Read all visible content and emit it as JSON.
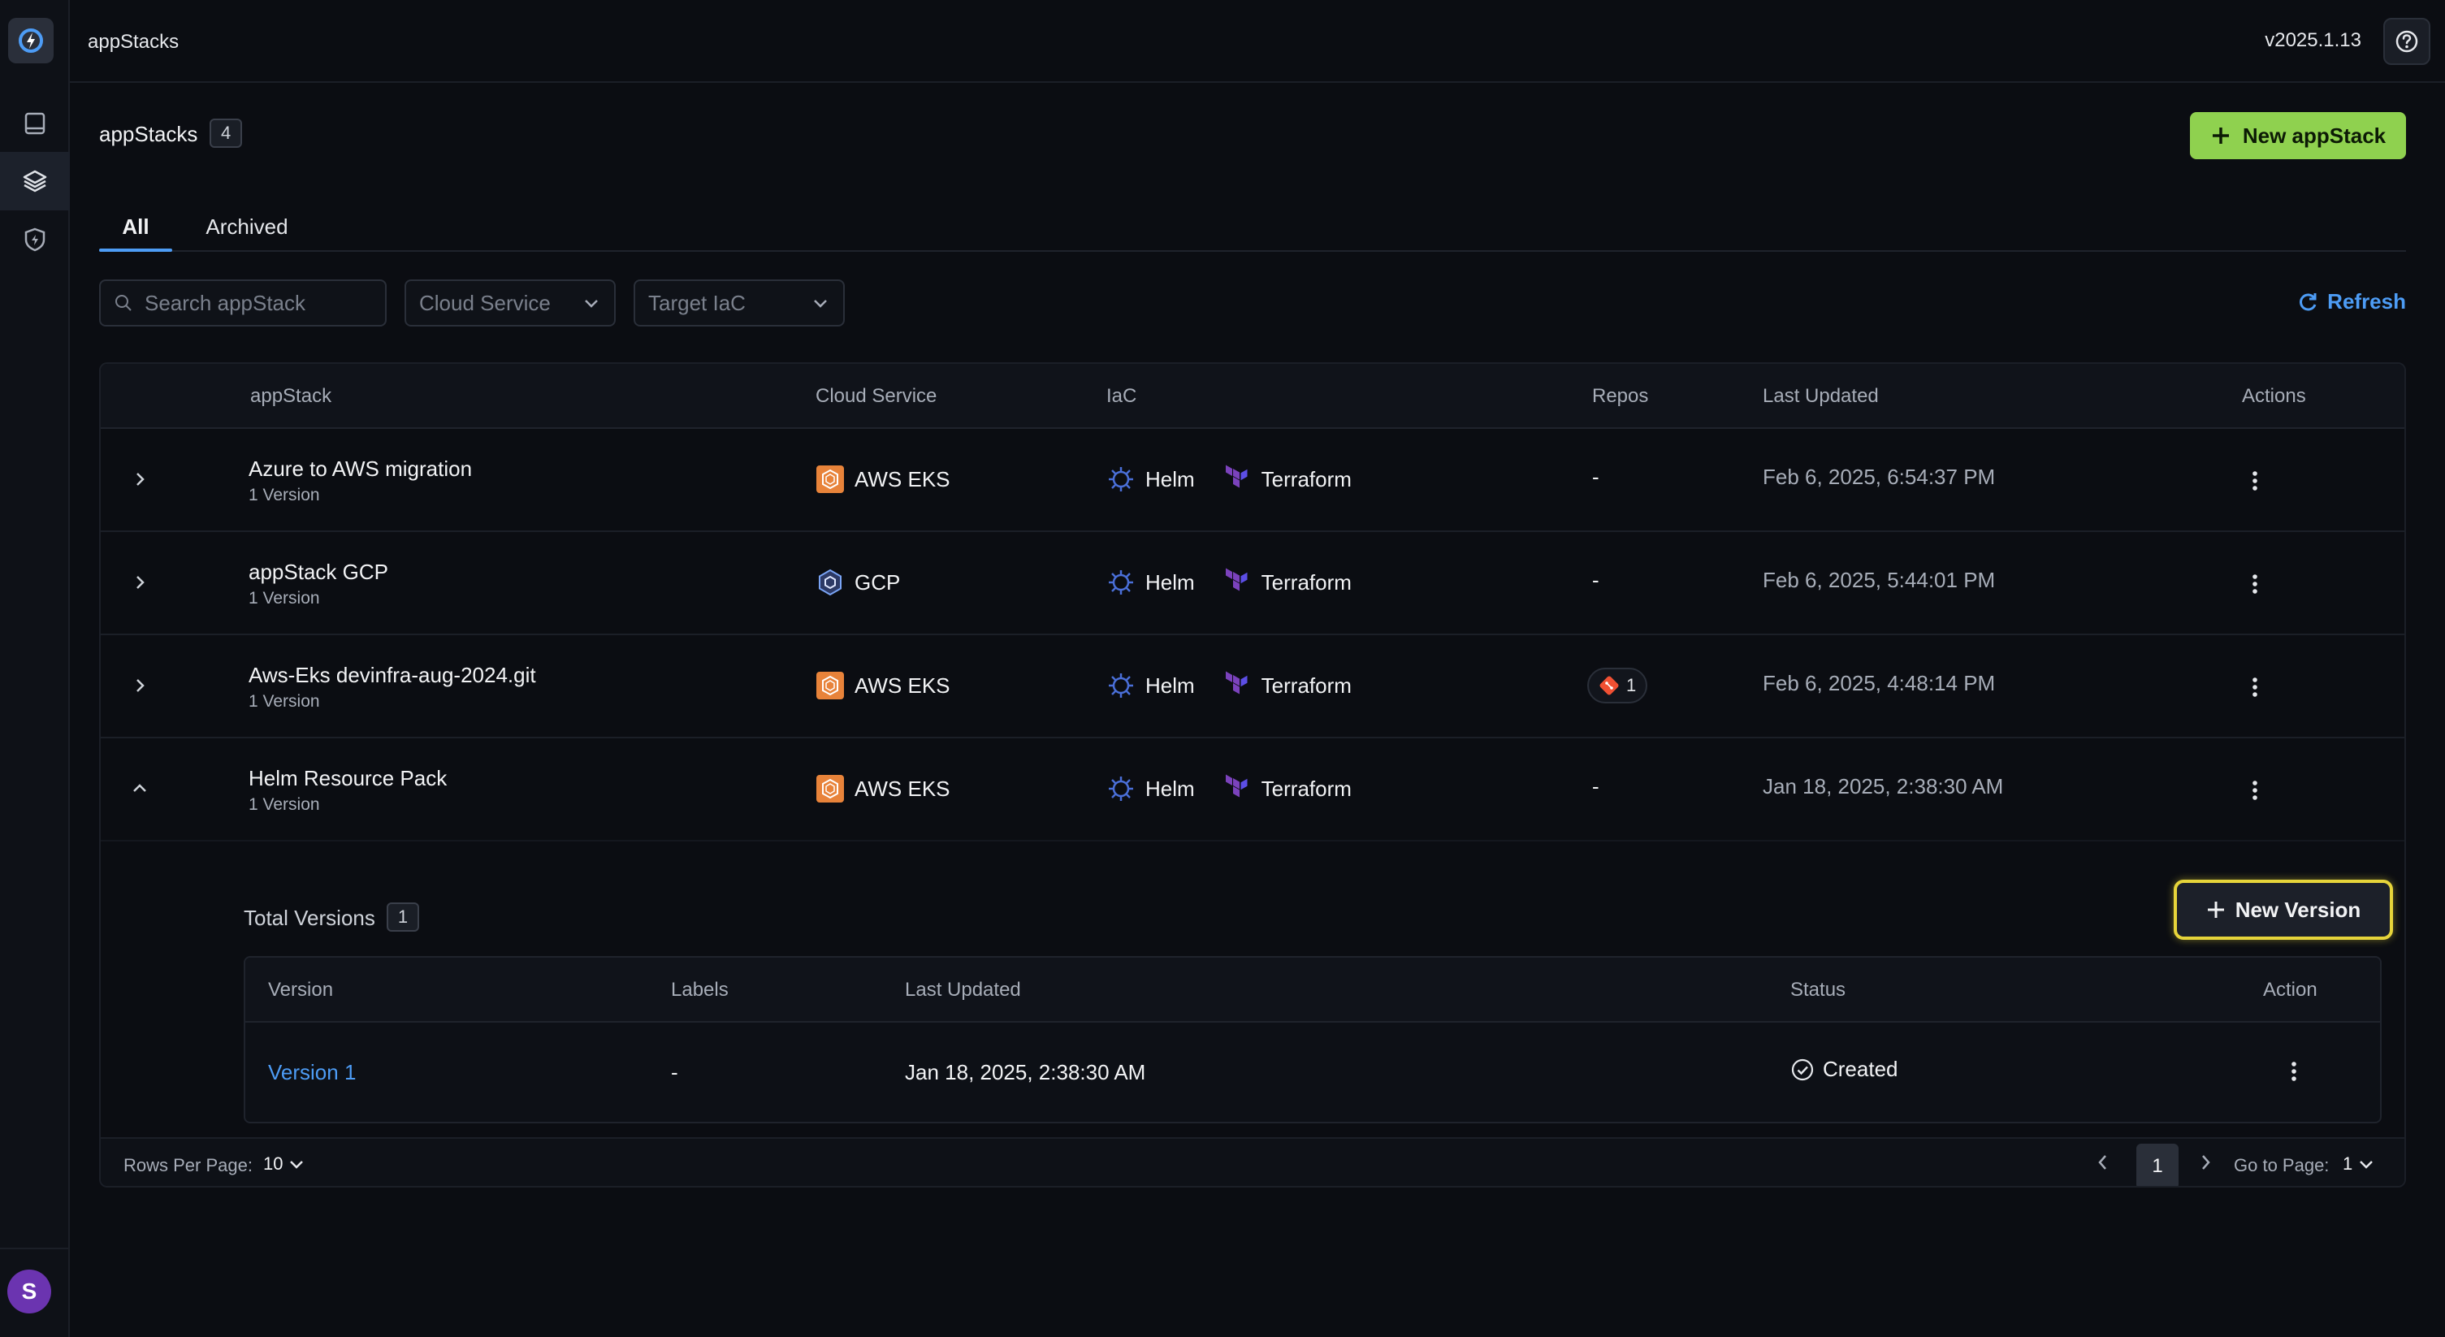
{
  "header": {
    "app_title": "appStacks",
    "version": "v2025.1.13"
  },
  "page": {
    "title": "appStacks",
    "count": "4",
    "new_button_label": "New appStack",
    "tabs": [
      {
        "label": "All",
        "active": true
      },
      {
        "label": "Archived",
        "active": false
      }
    ],
    "search_placeholder": "Search appStack",
    "filter_cloud_service": "Cloud Service",
    "filter_target_iac": "Target IaC",
    "refresh_label": "Refresh"
  },
  "table": {
    "headers": {
      "appstack": "appStack",
      "cloud_service": "Cloud Service",
      "iac": "IaC",
      "repos": "Repos",
      "last_updated": "Last Updated",
      "actions": "Actions"
    },
    "rows": [
      {
        "name": "Azure to AWS migration",
        "versions": "1 Version",
        "cloud": "AWS EKS",
        "cloud_icon": "aws-eks-icon",
        "iac1": "Helm",
        "iac2": "Terraform",
        "repos": "-",
        "last_updated": "Feb 6, 2025, 6:54:37 PM",
        "expanded": false
      },
      {
        "name": "appStack GCP",
        "versions": "1 Version",
        "cloud": "GCP",
        "cloud_icon": "gcp-icon",
        "iac1": "Helm",
        "iac2": "Terraform",
        "repos": "-",
        "last_updated": "Feb 6, 2025, 5:44:01 PM",
        "expanded": false
      },
      {
        "name": "Aws-Eks devinfra-aug-2024.git",
        "versions": "1 Version",
        "cloud": "AWS EKS",
        "cloud_icon": "aws-eks-icon",
        "iac1": "Helm",
        "iac2": "Terraform",
        "repos": "1",
        "repos_icon": "git-icon",
        "last_updated": "Feb 6, 2025, 4:48:14 PM",
        "expanded": false
      },
      {
        "name": "Helm Resource Pack",
        "versions": "1 Version",
        "cloud": "AWS EKS",
        "cloud_icon": "aws-eks-icon",
        "iac1": "Helm",
        "iac2": "Terraform",
        "repos": "-",
        "last_updated": "Jan 18, 2025, 2:38:30 AM",
        "expanded": true
      }
    ],
    "expanded": {
      "total_label": "Total Versions",
      "total_count": "1",
      "new_version_label": "New Version",
      "headers": {
        "version": "Version",
        "labels": "Labels",
        "last_updated": "Last Updated",
        "status": "Status",
        "action": "Action"
      },
      "rows": [
        {
          "version": "Version 1",
          "labels": "-",
          "last_updated": "Jan 18, 2025, 2:38:30 AM",
          "status": "Created"
        }
      ]
    },
    "footer": {
      "rows_per_page_label": "Rows Per Page:",
      "rows_per_page_value": "10",
      "current_page": "1",
      "goto_label": "Go to Page:",
      "goto_value": "1"
    }
  },
  "colors": {
    "accent_blue": "#4d9cf5",
    "primary_green": "#8fd14f",
    "highlight_yellow": "#e6d43a",
    "aws_orange": "#e8833a",
    "terraform_purple": "#7b42bc",
    "git_red": "#f05033"
  }
}
